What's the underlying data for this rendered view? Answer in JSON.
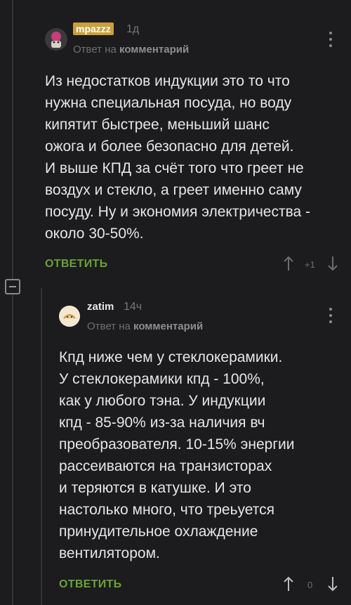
{
  "comments": [
    {
      "username": "mpazzz",
      "time": "1д",
      "reply_prefix": "Ответ на",
      "reply_target": "комментарий",
      "lines": [
        "Из недостатков индукции это то что",
        "нужна специальная посуда, но воду",
        "кипятит быстрее, меньший шанс",
        "ожога и более безопасно для детей.",
        "И выше КПД за счёт того что греет не",
        "воздух и стекло, а греет именно саму",
        "посуду. Ну и экономия электричества -",
        "около 30-50%."
      ],
      "reply_label": "ОТВЕТИТЬ",
      "rating": "+1",
      "badge_color": "#c8a13c"
    },
    {
      "username": "zatim",
      "time": "14ч",
      "reply_prefix": "Ответ на",
      "reply_target": "комментарий",
      "lines": [
        "Кпд ниже чем у стеклокерамики.",
        "У стеклокерамики кпд - 100%,",
        "как у любого тэна. У индукции",
        "кпд - 85-90% из-за наличия вч",
        "преобразователя. 10-15% энергии",
        "рассеиваются на транзисторах",
        "и теряются в катушке. И это",
        "настолько много, что треьуется",
        "принудительное охлаждение",
        "вентилятором."
      ],
      "reply_label": "ОТВЕТИТЬ",
      "rating": "0"
    }
  ],
  "colors": {
    "background": "#1c1c1e",
    "reply_green": "#6aa233",
    "muted": "#767676"
  },
  "icons": [
    "kebab-menu-icon",
    "arrow-up-icon",
    "arrow-down-icon",
    "collapse-icon"
  ]
}
